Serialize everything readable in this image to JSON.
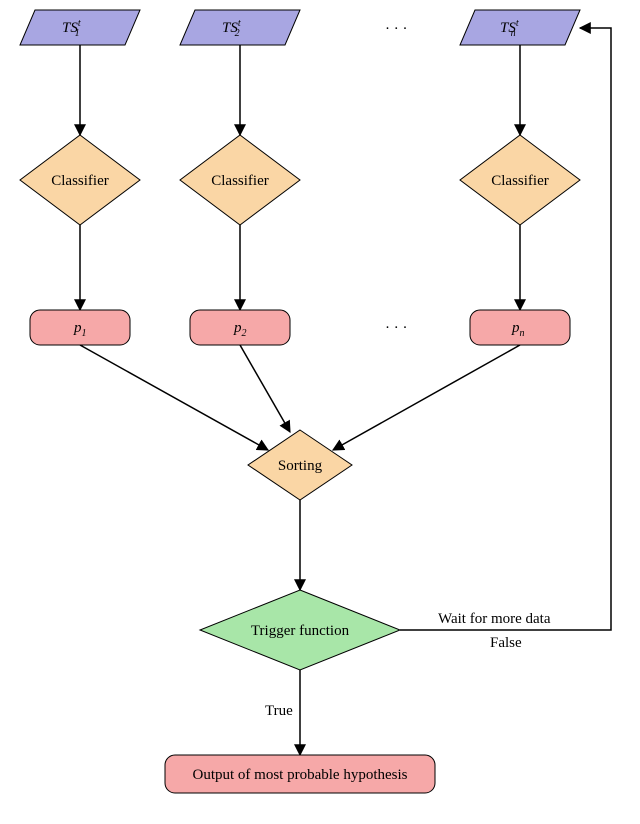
{
  "inputs": {
    "ts1": "TS",
    "ts1_sub": "1",
    "ts1_sup": "t",
    "ts2": "TS",
    "ts2_sub": "2",
    "ts2_sup": "t",
    "tsn": "TS",
    "tsn_sub": "n",
    "tsn_sup": "t",
    "dots_top": "· · ·"
  },
  "classifiers": {
    "c1": "Classifier",
    "c2": "Classifier",
    "cn": "Classifier"
  },
  "probs": {
    "p1": "p",
    "p1_sub": "1",
    "p2": "p",
    "p2_sub": "2",
    "pn": "p",
    "pn_sub": "n",
    "dots_mid": "· · ·"
  },
  "sorting": "Sorting",
  "trigger": "Trigger function",
  "edges": {
    "true": "True",
    "false": "False",
    "wait": "Wait for more data"
  },
  "output": "Output of most probable hypothesis",
  "colors": {
    "input": "#a8a6e2",
    "classifier": "#fad6a5",
    "prob": "#f6a8a8",
    "trigger": "#a8e6a8",
    "stroke": "#000"
  }
}
